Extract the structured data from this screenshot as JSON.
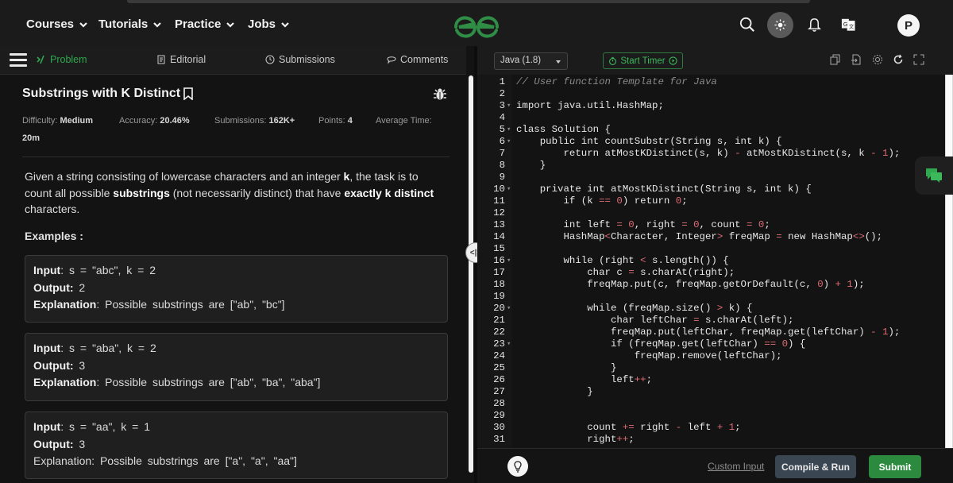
{
  "nav": {
    "items": [
      {
        "label": "Courses"
      },
      {
        "label": "Tutorials"
      },
      {
        "label": "Practice"
      },
      {
        "label": "Jobs"
      }
    ],
    "avatar_initial": "P"
  },
  "tabs": [
    {
      "label": "Problem",
      "icon": "code-icon",
      "active": true
    },
    {
      "label": "Editorial",
      "icon": "document-icon"
    },
    {
      "label": "Submissions",
      "icon": "clock-icon"
    },
    {
      "label": "Comments",
      "icon": "chat-bubble-icon"
    }
  ],
  "problem": {
    "title": "Substrings with K Distinct",
    "meta": {
      "difficulty_label": "Difficulty:",
      "difficulty": "Medium",
      "accuracy_label": "Accuracy:",
      "accuracy": "20.46%",
      "submissions_label": "Submissions:",
      "submissions": "162K+",
      "points_label": "Points:",
      "points": "4",
      "avg_time_label": "Average Time:",
      "avg_time": "20m"
    },
    "description": {
      "p1": "Given a string consisting of lowercase characters and an integer ",
      "k": "k",
      "p2": ", the task is to count all possible ",
      "substrings": "substrings",
      "p3": " (not necessarily distinct) that have ",
      "exactly": "exactly k distinct",
      "p4": " characters."
    },
    "examples_heading": "Examples :",
    "examples": [
      {
        "input_label": "Input",
        "input": ": s = \"abc\", k = 2",
        "output_label": "Output:",
        "output": " 2",
        "expl_label": "Explanation",
        "expl": ": Possible substrings are [\"ab\", \"bc\"]"
      },
      {
        "input_label": "Input",
        "input": ": s = \"aba\", k = 2",
        "output_label": "Output:",
        "output": " 3",
        "expl_label": "Explanation",
        "expl": ": Possible substrings are [\"ab\", \"ba\", \"aba\"]"
      },
      {
        "input_label": "Input",
        "input": ": s = \"aa\", k = 1",
        "output_label": "Output:",
        "output": " 3",
        "expl_label": "Explanation",
        "expl": "Explanation: Possible substrings are [\"a\", \"a\", \"aa\"]"
      }
    ]
  },
  "editor": {
    "language": "Java (1.8)",
    "timer_label": "Start Timer",
    "code_lines": [
      "// User function Template for Java",
      "",
      "import java.util.HashMap;",
      "",
      "class Solution {",
      "    public int countSubstr(String s, int k) {",
      "        return atMostKDistinct(s, k) - atMostKDistinct(s, k - 1);",
      "    }",
      "",
      "    private int atMostKDistinct(String s, int k) {",
      "        if (k == 0) return 0;",
      "",
      "        int left = 0, right = 0, count = 0;",
      "        HashMap<Character, Integer> freqMap = new HashMap<>();",
      "",
      "        while (right < s.length()) {",
      "            char c = s.charAt(right);",
      "            freqMap.put(c, freqMap.getOrDefault(c, 0) + 1);",
      "",
      "            while (freqMap.size() > k) {",
      "                char leftChar = s.charAt(left);",
      "                freqMap.put(leftChar, freqMap.get(leftChar) - 1);",
      "                if (freqMap.get(leftChar) == 0) {",
      "                    freqMap.remove(leftChar);",
      "                }",
      "                left++;",
      "            }",
      "",
      "",
      "            count += right - left + 1;",
      "            right++;"
    ],
    "fold_lines": [
      3,
      5,
      6,
      10,
      16,
      20,
      23
    ],
    "custom_input_label": "Custom Input",
    "compile_label": "Compile & Run",
    "submit_label": "Submit"
  },
  "colors": {
    "accent": "#2fa84f",
    "submit": "#2b8a3e",
    "compile": "#3a4652"
  }
}
